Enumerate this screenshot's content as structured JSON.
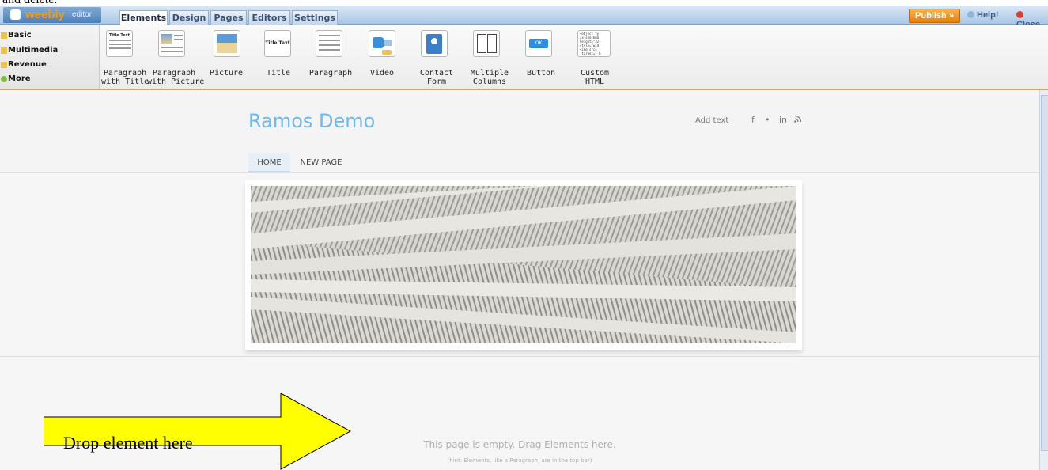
{
  "top_caption": "and delete.",
  "editor": {
    "logo_word": "weebly",
    "logo_sub": "editor",
    "tabs": [
      "Elements",
      "Design",
      "Pages",
      "Editors",
      "Settings"
    ],
    "publish_label": "Publish »",
    "help_label": "Help!",
    "close_label": "Close",
    "categories": [
      "Basic",
      "Multimedia",
      "Revenue",
      "More"
    ],
    "elements": [
      {
        "label": "Paragraph\nwith Title",
        "icon": "paragraph-with-title-icon"
      },
      {
        "label": "Paragraph\nwith Picture",
        "icon": "paragraph-with-picture-icon"
      },
      {
        "label": "Picture",
        "icon": "picture-icon"
      },
      {
        "label": "Title",
        "icon": "title-icon"
      },
      {
        "label": "Paragraph",
        "icon": "paragraph-icon"
      },
      {
        "label": "Video",
        "icon": "video-icon"
      },
      {
        "label": "Contact\nForm",
        "icon": "contact-form-icon"
      },
      {
        "label": "Multiple\nColumns",
        "icon": "multiple-columns-icon"
      },
      {
        "label": "Button",
        "icon": "button-icon"
      },
      {
        "label": "Custom\nHTML",
        "icon": "custom-html-icon"
      }
    ],
    "thumb_title_text": "Title Text",
    "thumb_button_text": "OK",
    "thumb_html_text": "<object ty\n/x-shockwa\nheight=\"32\nstyle=\"wid\n<img src=\n target=\"_b"
  },
  "site": {
    "title": "Ramos Demo",
    "add_text": "Add text",
    "social": [
      "f",
      "•",
      "in",
      "rss"
    ],
    "nav": [
      "HOME",
      "NEW PAGE"
    ],
    "empty_message": "This page is empty. Drag Elements here.",
    "empty_hint": "(hint: Elements, like a Paragraph, are in the top bar)"
  },
  "callout": {
    "label": "Drop element here"
  },
  "colors": {
    "accent_orange": "#e67e10",
    "site_title": "#6fb8ea",
    "callout_fill": "#ffff00"
  }
}
